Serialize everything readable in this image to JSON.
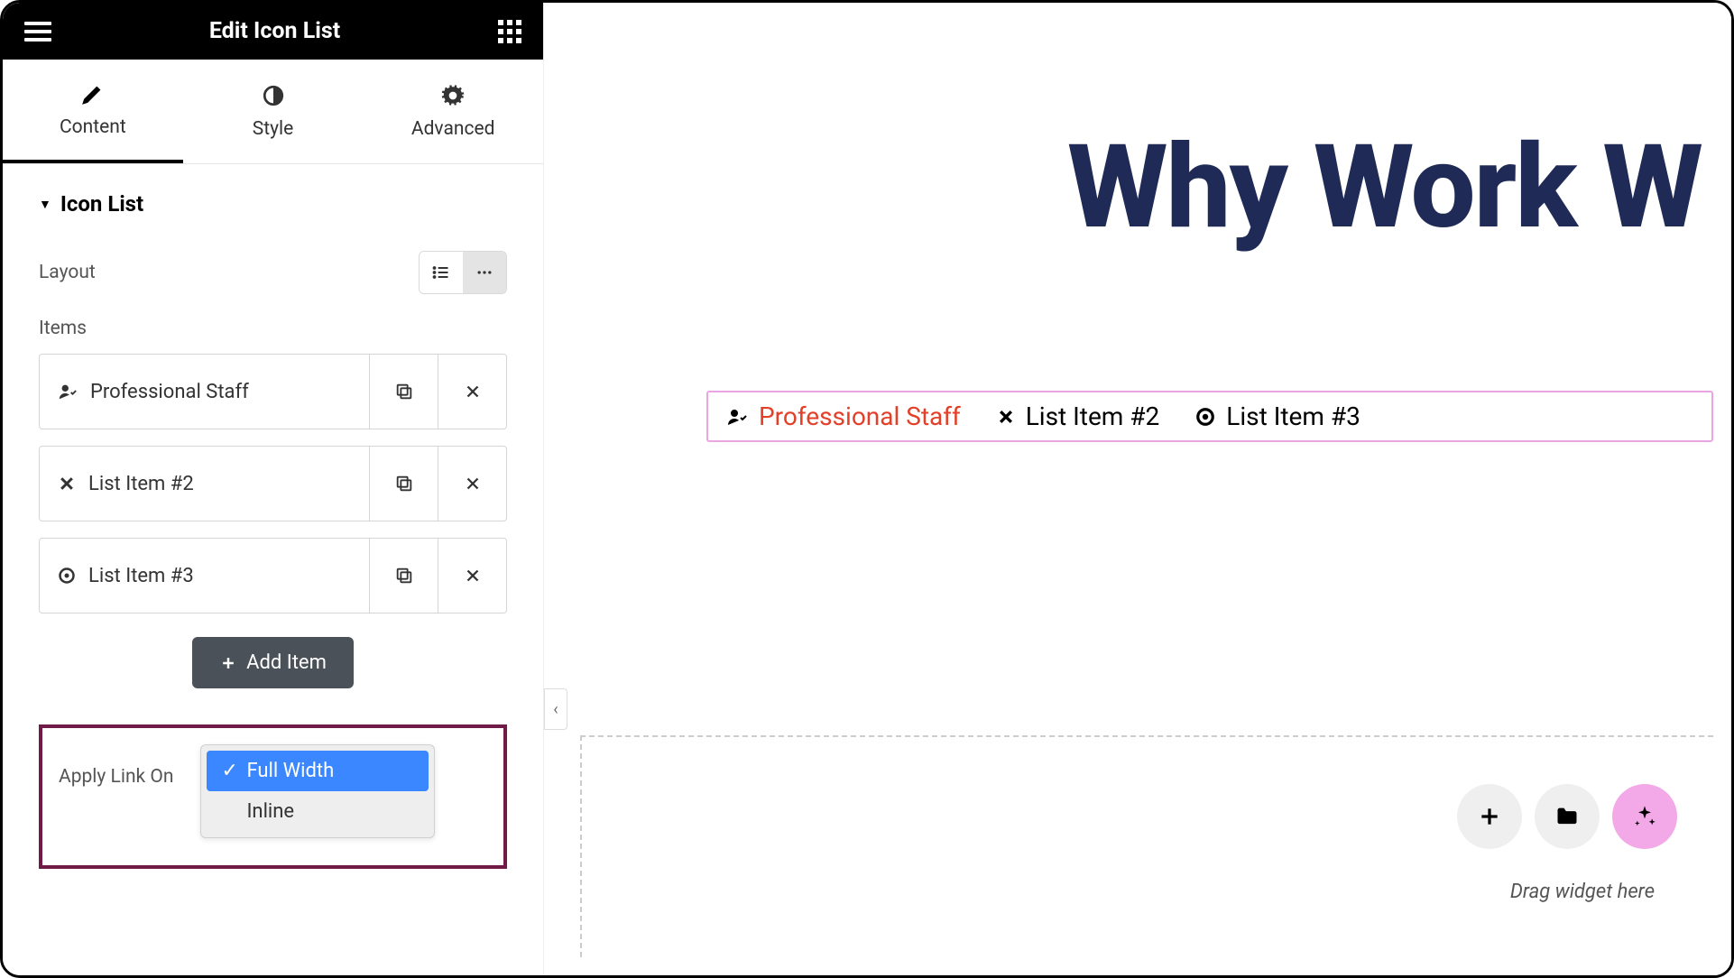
{
  "header": {
    "title": "Edit Icon List"
  },
  "tabs": {
    "content": "Content",
    "style": "Style",
    "advanced": "Advanced"
  },
  "section": {
    "title": "Icon List"
  },
  "layout": {
    "label": "Layout"
  },
  "items": {
    "label": "Items",
    "list": [
      {
        "label": "Professional Staff",
        "icon": "user-check"
      },
      {
        "label": "List Item #2",
        "icon": "x"
      },
      {
        "label": "List Item #3",
        "icon": "circle-dot"
      }
    ]
  },
  "addButton": {
    "label": "Add Item"
  },
  "applyLink": {
    "label": "Apply Link On",
    "options": {
      "full": "Full Width",
      "inline": "Inline"
    }
  },
  "canvas": {
    "heading": "Why Work W",
    "preview": {
      "item1": "Professional Staff",
      "item2": "List Item #2",
      "item3": "List Item #3"
    },
    "dragText": "Drag widget here"
  }
}
